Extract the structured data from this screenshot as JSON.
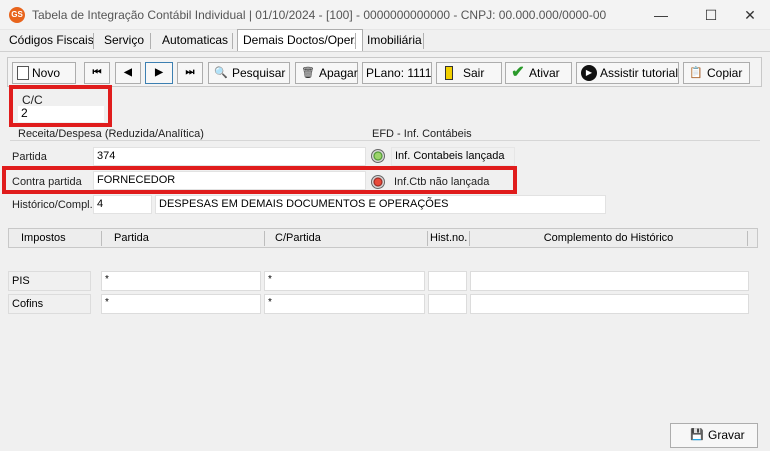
{
  "window": {
    "title": "Tabela de Integração Contábil Individual  |  01/10/2024 - [100] - 0000000000000 - CNPJ: 00.000.000/0000-00",
    "logo": "GS",
    "minimize": "—",
    "maximize": "☐",
    "close": "✕"
  },
  "tabs": [
    {
      "label": "Códigos Fiscais"
    },
    {
      "label": "Serviço"
    },
    {
      "label": "Automaticas"
    },
    {
      "label": "Demais Doctos/Oper."
    },
    {
      "label": "Imobiliária"
    }
  ],
  "toolbar": {
    "novo": "Novo",
    "first": "⏮",
    "prev": "◀",
    "next": "▶",
    "last": "⏭",
    "pesquisar": "Pesquisar",
    "apagar": "Apagar",
    "plano": "PLano: 1111",
    "sair": "Sair",
    "ativar": "Ativar",
    "assistir": "Assistir tutorial",
    "copiar": "Copiar"
  },
  "form": {
    "cc_label": "C/C",
    "cc_value": "2",
    "receita_label": "Receita/Despesa (Reduzida/Analítica)",
    "efd_label": "EFD - Inf. Contábeis",
    "partida_label": "Partida",
    "partida_value": "374",
    "inf_contabeis_status": "Inf. Contabeis lançada",
    "contra_partida_label": "Contra partida",
    "contra_partida_value": "FORNECEDOR",
    "inf_ctb_status": "Inf.Ctb não lançada",
    "historico_label": "Histórico/Compl.",
    "historico_code": "4",
    "historico_text": "DESPESAS EM DEMAIS DOCUMENTOS E OPERAÇÕES"
  },
  "grid": {
    "headers": [
      "Impostos",
      "Partida",
      "C/Partida",
      "Hist.no.",
      "Complemento do Histórico"
    ],
    "rows": [
      {
        "label": "PIS",
        "partida": "*",
        "cpartida": "*",
        "hist": "",
        "compl": ""
      },
      {
        "label": "Cofins",
        "partida": "*",
        "cpartida": "*",
        "hist": "",
        "compl": ""
      }
    ]
  },
  "footer": {
    "gravar": "Gravar"
  }
}
